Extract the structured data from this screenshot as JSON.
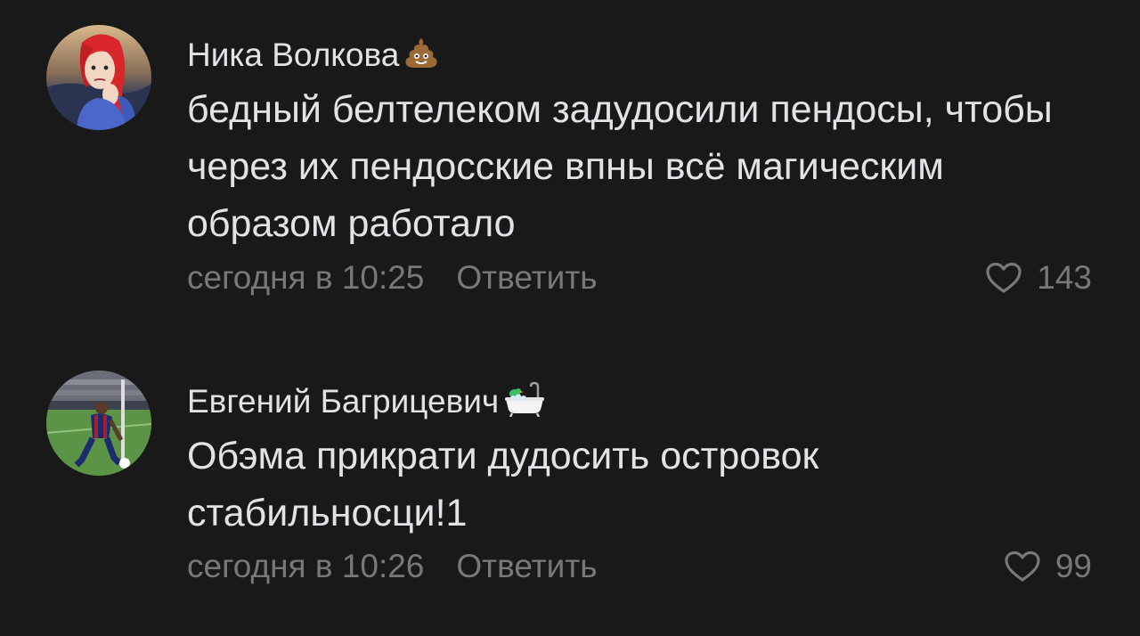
{
  "comments": [
    {
      "author": "Ника Волкова",
      "author_emoji": "pile-of-poo-icon",
      "text": "бедный белтелеком задудосили пендосы, чтобы через их пендосские впны всё магическим образом работало",
      "time": "сегодня в 10:25",
      "reply_label": "Ответить",
      "likes": "143"
    },
    {
      "author": "Евгений Багрицевич",
      "author_emoji": "bathtub-icon",
      "text": "Обэма прикрати дудосить островок стабильносци!1",
      "time": "сегодня в 10:26",
      "reply_label": "Ответить",
      "likes": "99"
    }
  ],
  "colors": {
    "background": "#191919",
    "text": "#e1e3e6",
    "secondary": "#76787a"
  }
}
